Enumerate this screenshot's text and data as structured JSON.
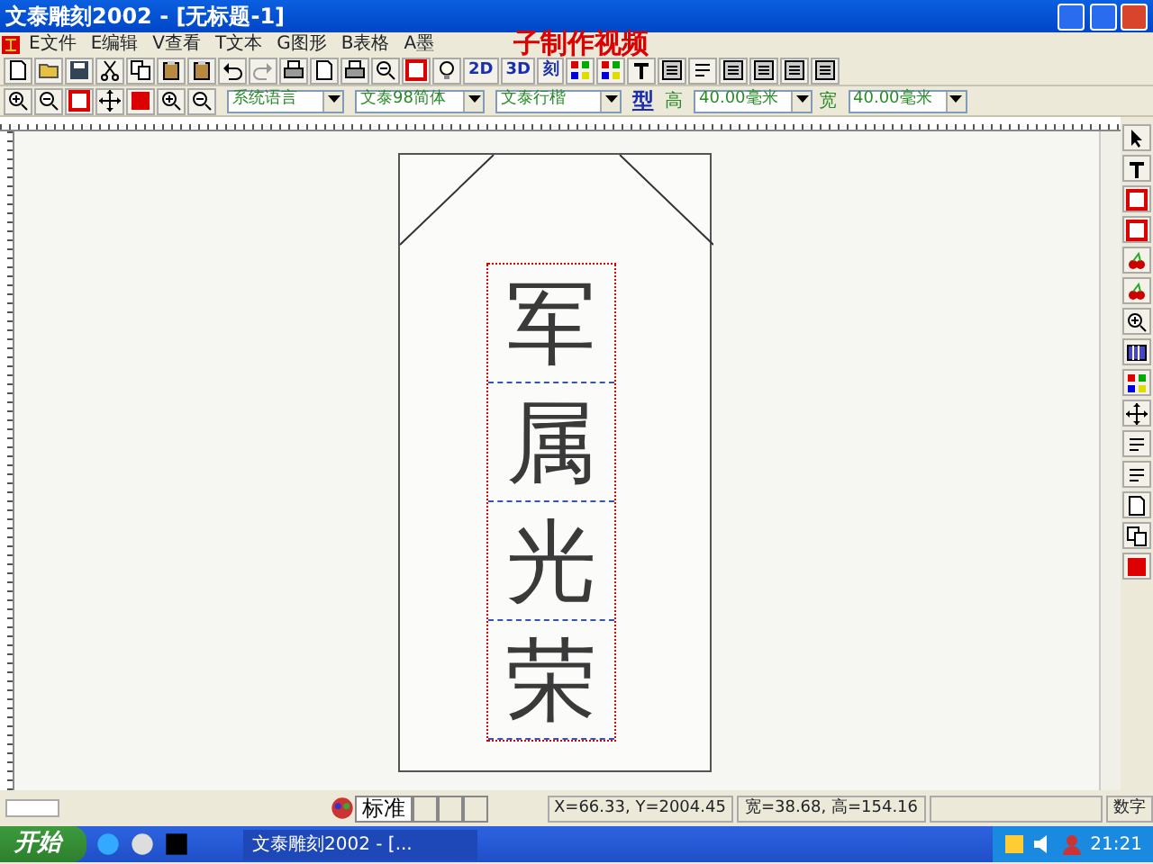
{
  "window": {
    "title": "文泰雕刻2002 - [无标题-1]"
  },
  "menu": [
    {
      "label": "E文件"
    },
    {
      "label": "E编辑"
    },
    {
      "label": "V查看"
    },
    {
      "label": "T文本"
    },
    {
      "label": "G图形"
    },
    {
      "label": "B表格"
    },
    {
      "label": "A墨"
    }
  ],
  "caption": "子制作视频",
  "toolbar_text_buttons": [
    "2D",
    "3D",
    "刻"
  ],
  "format_bar": {
    "language": "系统语言",
    "font_cn": "文泰98简体",
    "font": "文泰行楷",
    "type_label": "型",
    "height_label": "高",
    "height": "40.00毫米",
    "width_label": "宽",
    "width": "40.00毫米"
  },
  "canvas": {
    "characters": [
      "军",
      "属",
      "光",
      "荣"
    ]
  },
  "bottom_tabs": [
    {
      "label": "标准",
      "selected": true
    }
  ],
  "status_bar": {
    "position": "X=66.33, Y=2004.45",
    "size": "宽=38.68, 高=154.16",
    "mode": "数字"
  },
  "taskbar": {
    "start": "开始",
    "tasks": [
      {
        "label": "文泰雕刻2002 - [...",
        "selected": true
      }
    ],
    "clock": "21:21"
  }
}
